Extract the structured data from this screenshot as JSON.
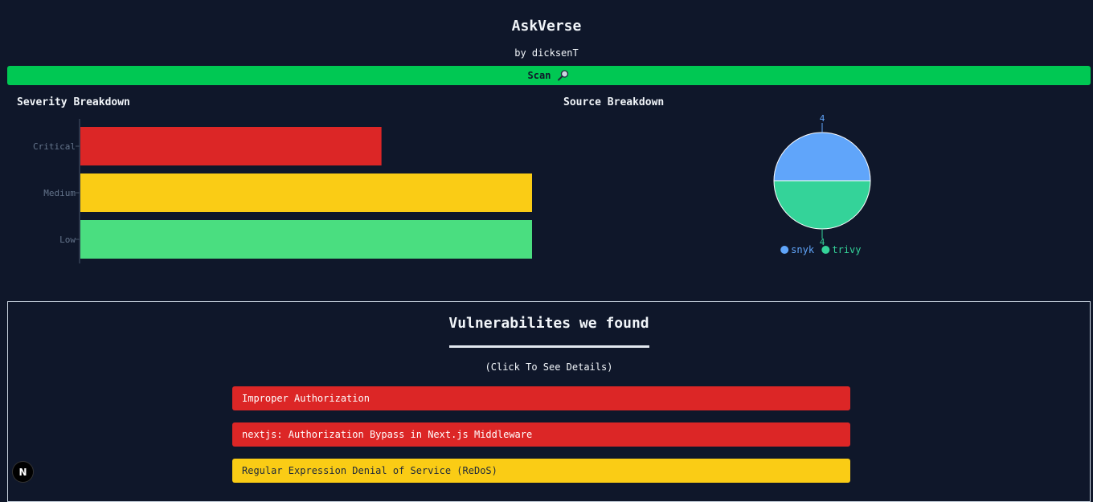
{
  "header": {
    "title": "AskVerse",
    "byline": "by dicksenT"
  },
  "scan": {
    "label": "Scan",
    "icon": "magnifier-icon",
    "color": "#00c853"
  },
  "severity_panel": {
    "title": "Severity Breakdown"
  },
  "source_panel": {
    "title": "Source Breakdown"
  },
  "chart_data": [
    {
      "type": "bar",
      "orientation": "horizontal",
      "categories": [
        "Critical",
        "Medium",
        "Low"
      ],
      "values": [
        2,
        3,
        3
      ],
      "colors": [
        "#dc2626",
        "#facc15",
        "#4ade80"
      ],
      "xlim": [
        0,
        3
      ],
      "grid": false
    },
    {
      "type": "pie",
      "labels": [
        "snyk",
        "trivy"
      ],
      "values": [
        4,
        4
      ],
      "colors": [
        "#60a5fa",
        "#34d399"
      ],
      "legend": "bottom"
    }
  ],
  "vulnerabilities": {
    "title": "Vulnerabilites we found",
    "hint": "(Click To See Details)",
    "items": [
      {
        "label": "Improper Authorization",
        "severity": "Critical",
        "color": "#dc2626",
        "text_color": "#ffffff"
      },
      {
        "label": "nextjs: Authorization Bypass in Next.js Middleware",
        "severity": "Critical",
        "color": "#dc2626",
        "text_color": "#ffffff"
      },
      {
        "label": "Regular Expression Denial of Service (ReDoS)",
        "severity": "Medium",
        "color": "#facc15",
        "text_color": "#1e293b"
      }
    ]
  },
  "dev_badge": {
    "label": "N"
  }
}
